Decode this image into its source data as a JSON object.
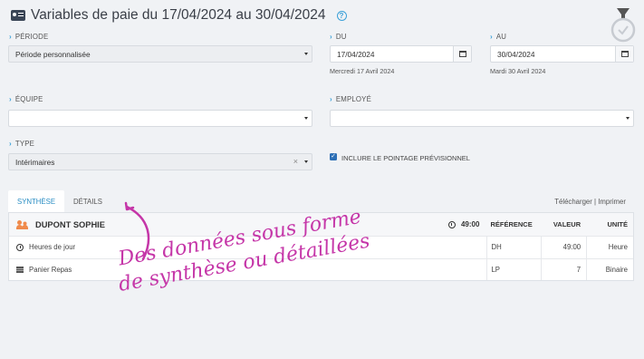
{
  "header": {
    "title": "Variables de paie du 17/04/2024 au 30/04/2024",
    "help": "?"
  },
  "form": {
    "periode": {
      "label": "Période",
      "value": "Période personnalisée"
    },
    "du": {
      "label": "Du",
      "value": "17/04/2024",
      "sub": "Mercredi 17 Avril 2024"
    },
    "au": {
      "label": "Au",
      "value": "30/04/2024",
      "sub": "Mardi 30 Avril 2024"
    },
    "equipe": {
      "label": "Équipe",
      "value": ""
    },
    "employe": {
      "label": "Employé",
      "value": ""
    },
    "type": {
      "label": "Type",
      "value": "Intérimaires",
      "clear": "×"
    },
    "checkbox": {
      "label": "Inclure le pointage prévisionnel",
      "checked": true
    }
  },
  "tabs": [
    {
      "label": "Synthèse",
      "active": true
    },
    {
      "label": "Détails",
      "active": false
    }
  ],
  "links": {
    "download": "Télécharger",
    "separator": "|",
    "print": "Imprimer"
  },
  "table": {
    "employee": {
      "name": "DUPONT SOPHIE",
      "hours": "49:00"
    },
    "headers": {
      "ref": "Référence",
      "value": "Valeur",
      "unit": "Unité"
    },
    "rows": [
      {
        "icon": "clock-icon",
        "label": "Heures de jour",
        "ref": "DH",
        "value": "49:00",
        "unit": "Heure"
      },
      {
        "icon": "meal-icon",
        "label": "Panier Repas",
        "ref": "LP",
        "value": "7",
        "unit": "Binaire"
      }
    ]
  },
  "annotation": {
    "line1": "Des données sous forme",
    "line2": "de synthèse ou détaillées"
  },
  "colors": {
    "accent": "#2a8ec4",
    "annotation": "#c536a8",
    "checkbox": "#2d6fb5",
    "people": "#f08a4b"
  }
}
